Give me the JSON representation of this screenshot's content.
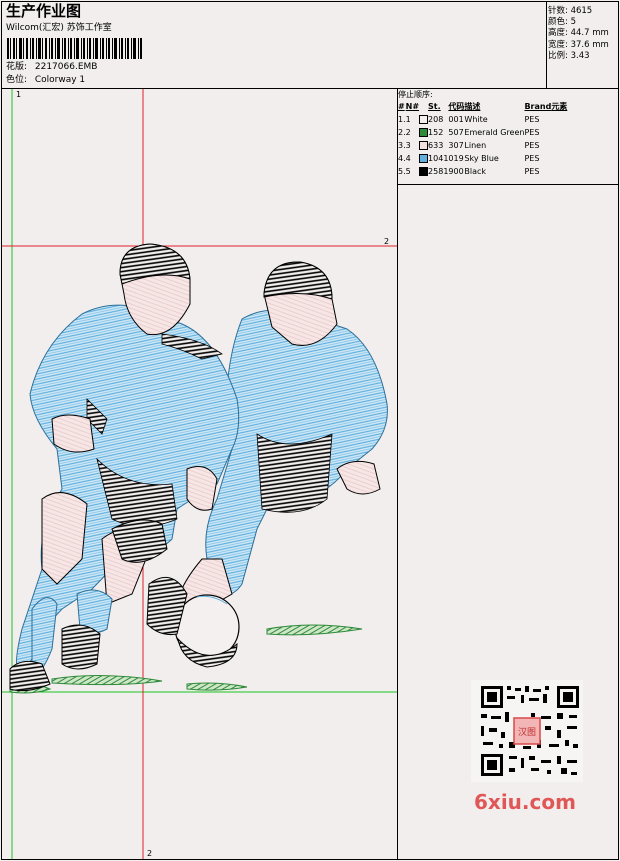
{
  "header": {
    "title": "生产作业图",
    "subtitle": "Wilcom(汇宏) 苏饰工作室",
    "design_label": "花版:",
    "design_value": "2217066.EMB",
    "colorway_label": "色位:",
    "colorway_value": "Colorway 1"
  },
  "stats": {
    "stitches_label": "针数:",
    "stitches_value": "4615",
    "colors_label": "颜色:",
    "colors_value": "5",
    "height_label": "高度:",
    "height_value": "44.7 mm",
    "width_label": "宽度:",
    "width_value": "37.6 mm",
    "scale_label": "比例:",
    "scale_value": "3.43"
  },
  "legend": {
    "title": "停止顺序:",
    "headers": [
      "#",
      "N#",
      "",
      "St.",
      "代码",
      "描述",
      "Brand",
      "元素"
    ],
    "rows": [
      {
        "num": "1.",
        "n": "1",
        "color": "#f4efef",
        "st": "208",
        "code": "001",
        "desc": "White",
        "brand": "PES"
      },
      {
        "num": "2.",
        "n": "2",
        "color": "#2f8a3a",
        "st": "152",
        "code": "507",
        "desc": "Emerald Green",
        "brand": "PES"
      },
      {
        "num": "3.",
        "n": "3",
        "color": "#f4dede",
        "st": "633",
        "code": "307",
        "desc": "Linen",
        "brand": "PES"
      },
      {
        "num": "4.",
        "n": "4",
        "color": "#5fb0df",
        "st": "1041",
        "code": "019",
        "desc": "Sky Blue",
        "brand": "PES"
      },
      {
        "num": "5.",
        "n": "5",
        "color": "#000000",
        "st": "2581",
        "code": "900",
        "desc": "Black",
        "brand": "PES"
      }
    ]
  },
  "markers": {
    "top": "1",
    "right": "2",
    "bottom": "2"
  },
  "watermark": {
    "brand": "6xiu.com",
    "seal": "汉图"
  },
  "colors": {
    "guide_red": "#e0202a",
    "guide_green": "#19c41e",
    "sky_blue": "#5fb0df",
    "emerald": "#2f8a3a",
    "linen": "#f4dede"
  }
}
